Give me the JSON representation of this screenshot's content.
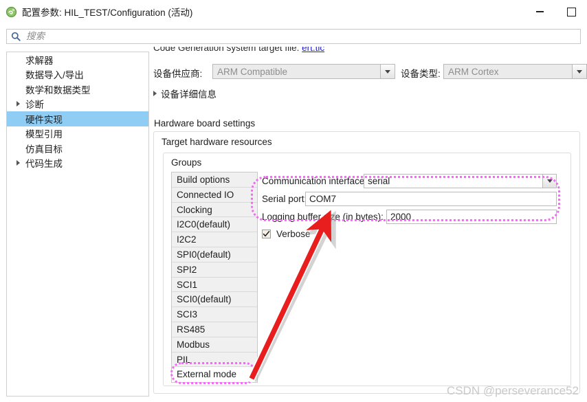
{
  "window": {
    "title": "配置参数: HIL_TEST/Configuration (活动)",
    "icon": "simulink-icon",
    "minimize_label": "最小化",
    "maximize_label": "最大化"
  },
  "search": {
    "placeholder": "搜索",
    "value": "",
    "icon": "search-icon"
  },
  "sidebar": {
    "items": [
      {
        "label": "求解器",
        "expandable": false,
        "selected": false
      },
      {
        "label": "数据导入/导出",
        "expandable": false,
        "selected": false
      },
      {
        "label": "数学和数据类型",
        "expandable": false,
        "selected": false
      },
      {
        "label": "诊断",
        "expandable": true,
        "selected": false
      },
      {
        "label": "硬件实现",
        "expandable": false,
        "selected": true
      },
      {
        "label": "模型引用",
        "expandable": false,
        "selected": false
      },
      {
        "label": "仿真目标",
        "expandable": false,
        "selected": false
      },
      {
        "label": "代码生成",
        "expandable": true,
        "selected": false
      }
    ]
  },
  "content": {
    "system_target_file": {
      "label": "Code Generation system target file:",
      "link": "ert.tlc"
    },
    "device_vendor": {
      "label": "设备供应商:",
      "value": "ARM Compatible"
    },
    "device_type": {
      "label": "设备类型:",
      "value": "ARM Cortex"
    },
    "device_details": {
      "label": "设备详细信息",
      "expanded": false
    },
    "hardware_board_settings_title": "Hardware board settings",
    "target_hardware_resources": {
      "label": "Target hardware resources",
      "expanded": true,
      "groups_label": "Groups",
      "groups": [
        "Build options",
        "Connected IO",
        "Clocking",
        "I2C0(default)",
        "I2C2",
        "SPI0(default)",
        "SPI2",
        "SCI1",
        "SCI0(default)",
        "SCI3",
        "RS485",
        "Modbus",
        "PIL",
        "External mode"
      ],
      "selected_group": "External mode",
      "form": {
        "communication_interface": {
          "label": "Communication interface:",
          "value": "serial"
        },
        "serial_port": {
          "label": "Serial port:",
          "value": "COM7"
        },
        "logging_buffer_size": {
          "label": "Logging buffer size (in bytes):",
          "value": "2000"
        },
        "verbose": {
          "label": "Verbose",
          "checked": true
        }
      }
    }
  },
  "annotations": {
    "highlight_color": "#f06cf0",
    "arrow_color": "#e81d1d"
  },
  "watermark": "CSDN @perseverance52"
}
